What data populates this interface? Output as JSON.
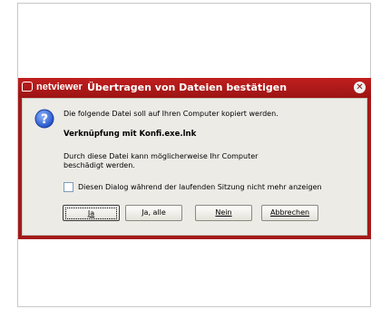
{
  "dialog": {
    "brand": "netviewer",
    "title": "Übertragen von Dateien bestätigen",
    "message": "Die folgende Datei soll auf Ihren Computer kopiert werden.",
    "filename": "Verknüpfung mit Konfi.exe.lnk",
    "warning": "Durch diese Datei kann möglicherweise Ihr Computer beschädigt werden.",
    "checkbox_label": "Diesen Dialog während der laufenden Sitzung nicht mehr anzeigen",
    "checkbox_checked": false
  },
  "buttons": {
    "yes_label": "Ja",
    "yes_all_label": "Ja, alle",
    "no_label": "Nein",
    "cancel_label": "Abbrechen"
  },
  "colors": {
    "titlebar": "#a41a1a",
    "panel": "#ecebe6"
  }
}
